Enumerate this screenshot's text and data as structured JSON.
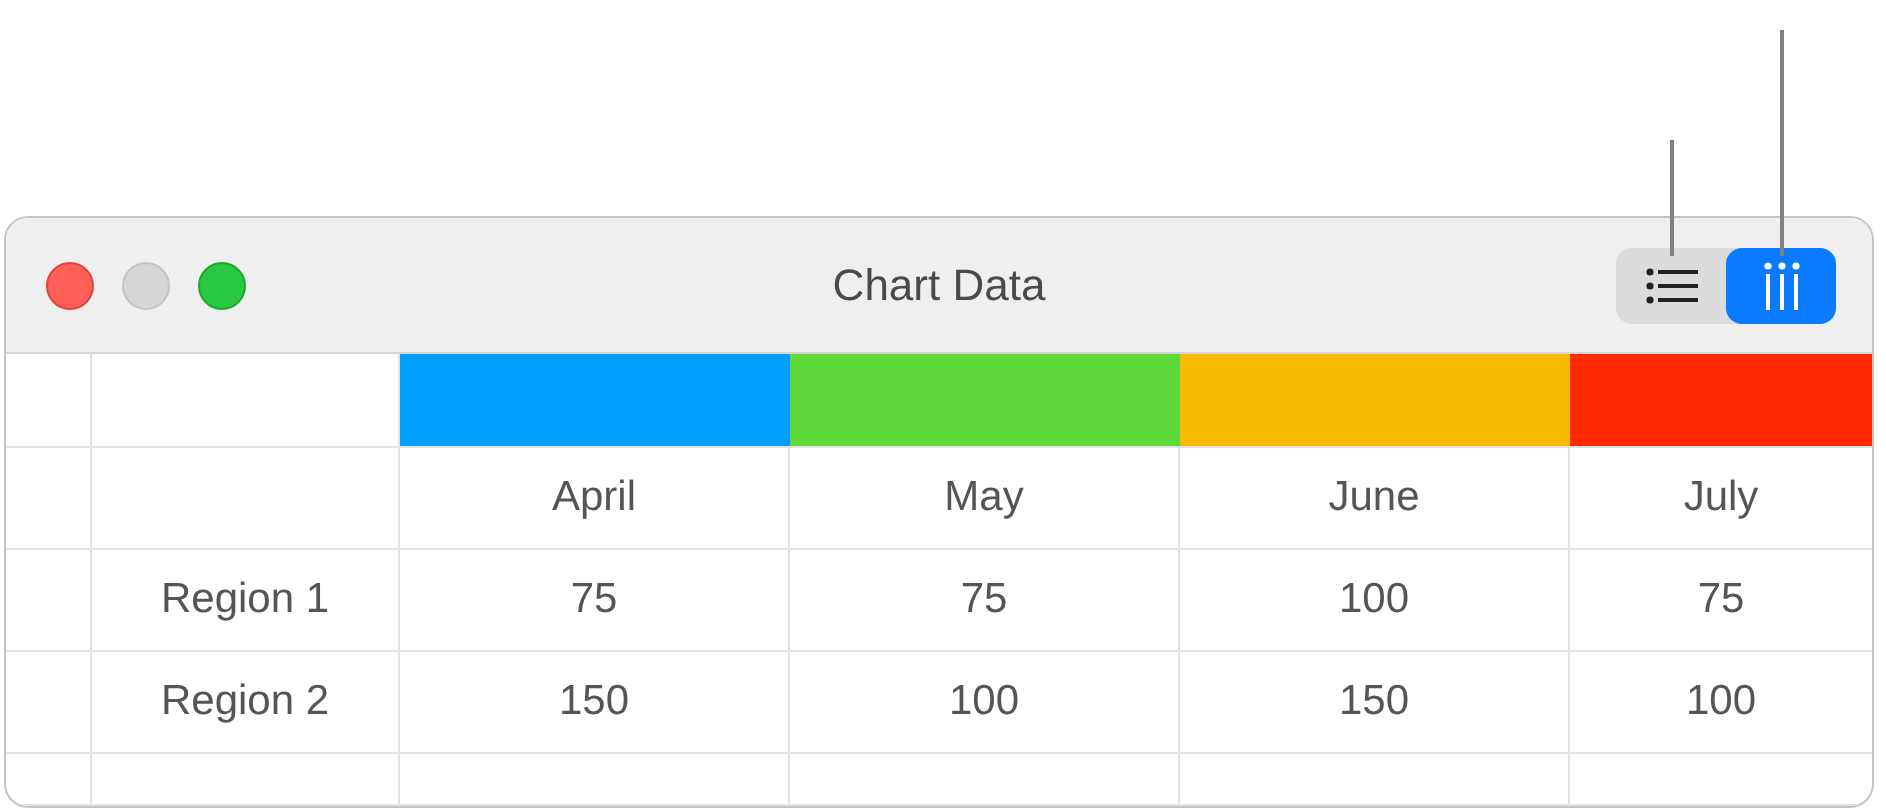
{
  "window": {
    "title": "Chart Data"
  },
  "view_buttons": [
    {
      "kind": "rows",
      "selected": false
    },
    {
      "kind": "columns",
      "selected": true
    }
  ],
  "table": {
    "series": [
      {
        "color": "#019ffe"
      },
      {
        "color": "#5fd93a"
      },
      {
        "color": "#f8bb00"
      },
      {
        "color": "#ff2a00"
      }
    ],
    "columns": [
      "April",
      "May",
      "June",
      "July"
    ],
    "rows": [
      {
        "label": "Region 1",
        "cells": [
          "75",
          "75",
          "100",
          "75"
        ]
      },
      {
        "label": "Region 2",
        "cells": [
          "150",
          "100",
          "150",
          "100"
        ]
      }
    ]
  }
}
